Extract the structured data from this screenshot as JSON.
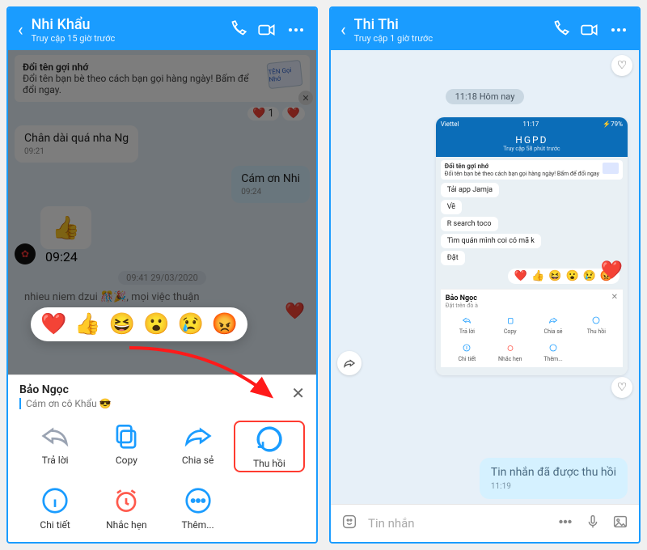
{
  "left": {
    "header": {
      "name": "Nhi Khẩu",
      "sub": "Truy cập 15 giờ trước"
    },
    "tip": {
      "title": "Đổi tên gợi nhớ",
      "body": "Đổi tên bạn bè theo cách bạn gọi hàng ngày! Bấm để đổi ngay.",
      "badge": "TÊN Gọi Nhớ"
    },
    "react_count": "1",
    "msgs": {
      "m1": {
        "text": "Chân dài quá nha Ng",
        "time": "09:21"
      },
      "m2": {
        "text": "Cám ơn Nhi",
        "time": "09:24"
      },
      "m3_time": "09:24",
      "ts": "09:41 29/03/2020",
      "trunc": "nhieu niem dzui 🎊🎉, mọi việc thuận"
    },
    "reactions": [
      "❤️",
      "👍",
      "😆",
      "😮",
      "😢",
      "😡"
    ],
    "sheet": {
      "user": "Bảo Ngọc",
      "msg": "Cám ơn cô Khẩu 😎",
      "actions": {
        "reply": "Trả lời",
        "copy": "Copy",
        "share": "Chia sẻ",
        "recall": "Thu hồi",
        "detail": "Chi tiết",
        "remind": "Nhắc hẹn",
        "more": "Thêm..."
      }
    }
  },
  "right": {
    "header": {
      "name": "Thi Thi",
      "sub": "Truy cập 1 giờ trước"
    },
    "day": "11:18 Hôm nay",
    "ss": {
      "status": {
        "left": "Viettel",
        "center": "11:17",
        "right": "79%"
      },
      "hdr": {
        "name": "HGPD",
        "sub": "Truy cập 58 phút trước"
      },
      "tip": {
        "title": "Đổi tên gợi nhớ",
        "body": "Đổi tên bạn bè theo cách bạn gọi hàng ngày! Bấm để đổi ngay"
      },
      "bubs": [
        "Tải app Jamja",
        "Về",
        "R search toco",
        "Tìm quán mình coi có mã k",
        "Đặt"
      ],
      "reactions": [
        "❤️",
        "👍",
        "😆",
        "😮",
        "😢",
        "😡"
      ],
      "sheet": {
        "user": "Bảo Ngọc",
        "msg": "Đặt trên đó à",
        "a": {
          "reply": "Trả lời",
          "copy": "Copy",
          "share": "Chia sẻ",
          "recall": "Thu hồi",
          "detail": "Chi tiết",
          "remind": "Nhắc hẹn",
          "more": "Thêm..."
        }
      }
    },
    "recalled": {
      "text": "Tin nhắn đã được thu hồi",
      "time": "11:19"
    },
    "input_placeholder": "Tin nhắn"
  }
}
